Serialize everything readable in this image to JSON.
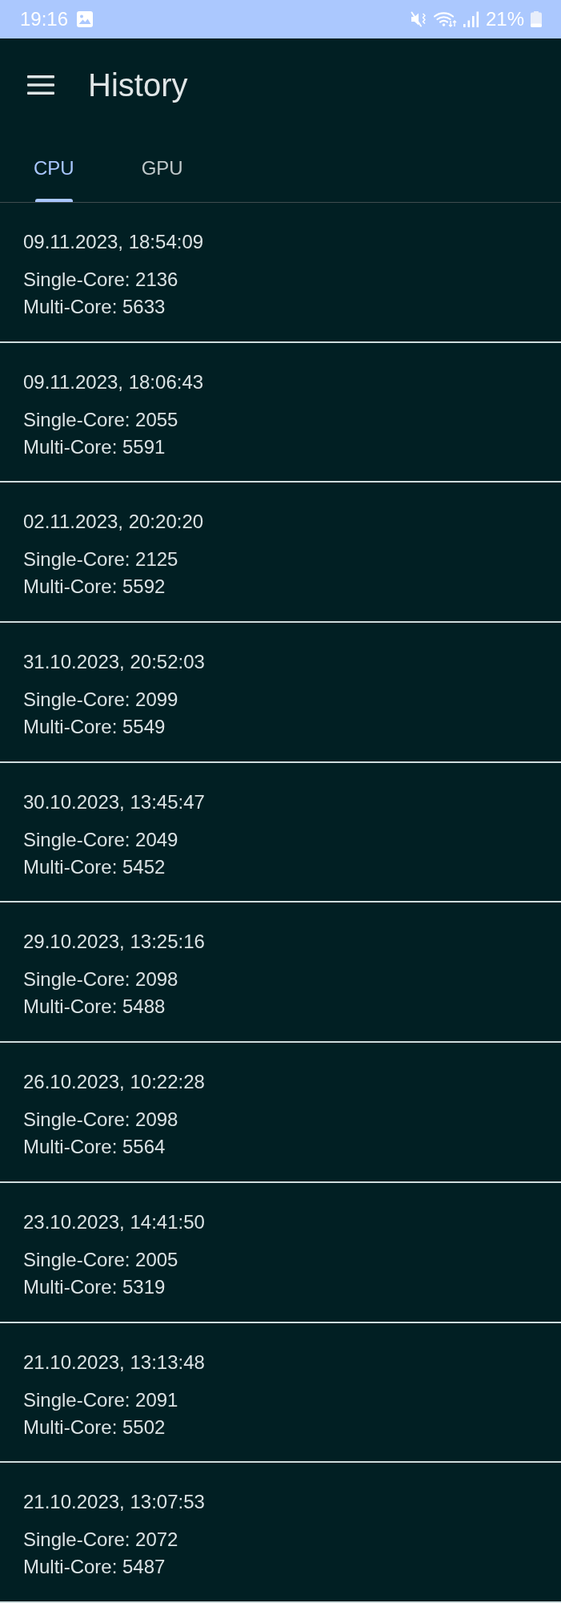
{
  "status_bar": {
    "time": "19:16",
    "battery": "21%"
  },
  "app_bar": {
    "title": "History"
  },
  "tabs": [
    {
      "label": "CPU",
      "selected": true
    },
    {
      "label": "GPU",
      "selected": false
    }
  ],
  "results": [
    {
      "date": "09.11.2023, 18:54:09",
      "single_core": "Single-Core: 2136",
      "multi_core": "Multi-Core: 5633"
    },
    {
      "date": "09.11.2023, 18:06:43",
      "single_core": "Single-Core: 2055",
      "multi_core": "Multi-Core: 5591"
    },
    {
      "date": "02.11.2023, 20:20:20",
      "single_core": "Single-Core: 2125",
      "multi_core": "Multi-Core: 5592"
    },
    {
      "date": "31.10.2023, 20:52:03",
      "single_core": "Single-Core: 2099",
      "multi_core": "Multi-Core: 5549"
    },
    {
      "date": "30.10.2023, 13:45:47",
      "single_core": "Single-Core: 2049",
      "multi_core": "Multi-Core: 5452"
    },
    {
      "date": "29.10.2023, 13:25:16",
      "single_core": "Single-Core: 2098",
      "multi_core": "Multi-Core: 5488"
    },
    {
      "date": "26.10.2023, 10:22:28",
      "single_core": "Single-Core: 2098",
      "multi_core": "Multi-Core: 5564"
    },
    {
      "date": "23.10.2023, 14:41:50",
      "single_core": "Single-Core: 2005",
      "multi_core": "Multi-Core: 5319"
    },
    {
      "date": "21.10.2023, 13:13:48",
      "single_core": "Single-Core: 2091",
      "multi_core": "Multi-Core: 5502"
    },
    {
      "date": "21.10.2023, 13:07:53",
      "single_core": "Single-Core: 2072",
      "multi_core": "Multi-Core: 5487"
    }
  ]
}
